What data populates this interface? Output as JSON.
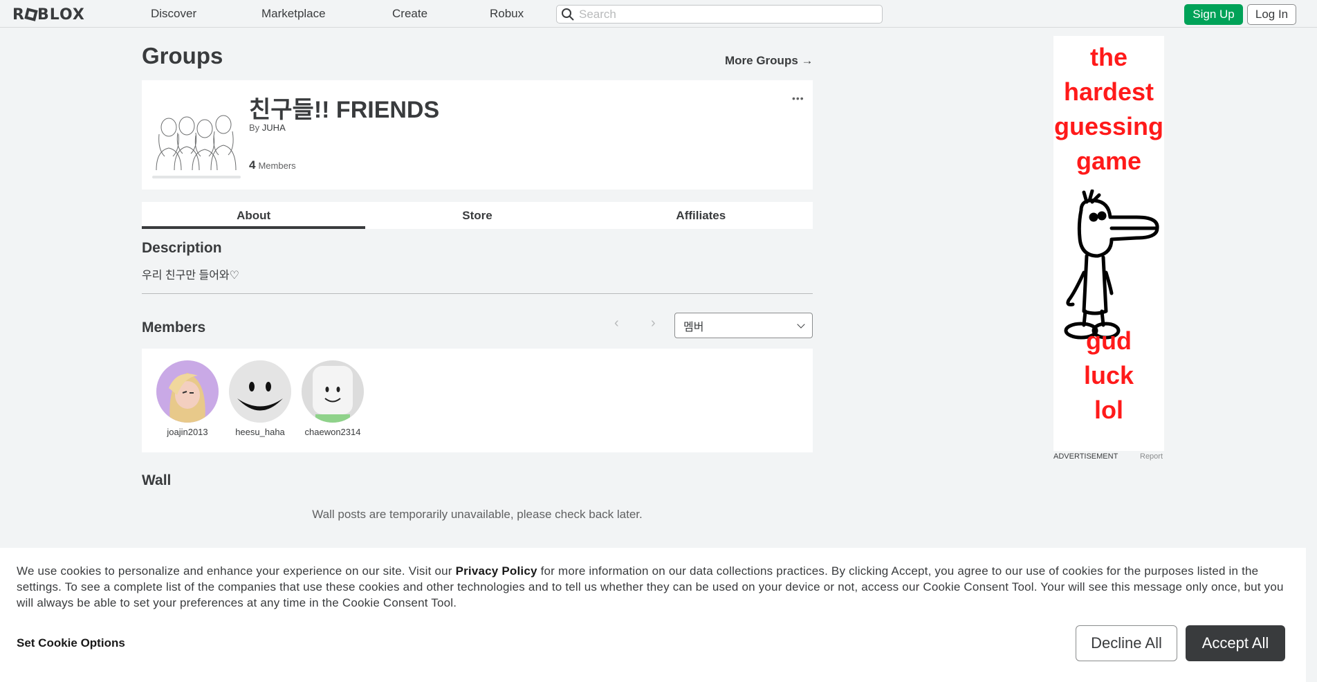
{
  "nav": {
    "logo": "ROBLOX",
    "links": [
      "Discover",
      "Marketplace",
      "Create",
      "Robux"
    ],
    "search_placeholder": "Search",
    "signup": "Sign Up",
    "login": "Log In"
  },
  "header": {
    "title": "Groups",
    "more_groups": "More Groups →"
  },
  "group": {
    "name": "친구들!! FRIENDS",
    "by_label": "By",
    "owner": "JUHA",
    "member_count": "4",
    "member_label": "Members",
    "more": "•••"
  },
  "tabs": [
    "About",
    "Store",
    "Affiliates"
  ],
  "about": {
    "description_heading": "Description",
    "description": "우리 친구만 들어와♡",
    "members_heading": "Members",
    "role_select": "멤버",
    "members": [
      {
        "name": "joajin2013"
      },
      {
        "name": "heesu_haha"
      },
      {
        "name": "chaewon2314"
      }
    ],
    "wall_heading": "Wall",
    "wall_message": "Wall posts are temporarily unavailable, please check back later."
  },
  "ad": {
    "lines_top": [
      "the",
      "hardest",
      "guessing",
      "game"
    ],
    "lines_bottom": [
      "gud",
      "luck",
      "lol"
    ],
    "label": "ADVERTISEMENT",
    "report": "Report"
  },
  "cookie": {
    "text_before": "We use cookies to personalize and enhance your experience on our site. Visit our ",
    "privacy": "Privacy Policy",
    "text_after": " for more information on our data collections practices. By clicking Accept, you agree to our use of cookies for the purposes listed in the settings. To see a complete list of the companies that use these cookies and other technologies and to tell us whether they can be used on your device or not, access our Cookie Consent Tool. Your will see this message only once, but you will always be able to set your preferences at any time in the Cookie Consent Tool.",
    "set_options": "Set Cookie Options",
    "decline": "Decline All",
    "accept": "Accept All"
  }
}
